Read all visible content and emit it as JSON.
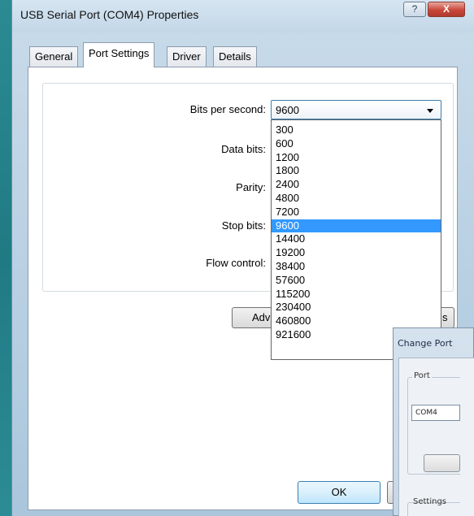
{
  "window": {
    "title": "USB Serial Port (COM4) Properties",
    "help_label": "?",
    "close_label": "X"
  },
  "tabs": [
    {
      "label": "General",
      "active": false
    },
    {
      "label": "Port Settings",
      "active": true
    },
    {
      "label": "Driver",
      "active": false
    },
    {
      "label": "Details",
      "active": false
    }
  ],
  "port_settings": {
    "bits_per_second_label": "Bits per second:",
    "bits_per_second_value": "9600",
    "data_bits_label": "Data bits:",
    "parity_label": "Parity:",
    "stop_bits_label": "Stop bits:",
    "flow_control_label": "Flow control:"
  },
  "dropdown": {
    "options": [
      "300",
      "600",
      "1200",
      "1800",
      "2400",
      "4800",
      "7200",
      "9600",
      "14400",
      "19200",
      "38400",
      "57600",
      "115200",
      "230400",
      "460800",
      "921600"
    ],
    "selected": "9600"
  },
  "buttons": {
    "advanced_label": "Adv",
    "advanced_tail": "s",
    "ok_label": "OK"
  },
  "change_port": {
    "title": "Change Port",
    "port_group_label": "Port",
    "port_value": "COM4",
    "settings_group_label": "Settings"
  },
  "colors": {
    "selection": "#3399ff",
    "desktop": "#124e5a"
  }
}
